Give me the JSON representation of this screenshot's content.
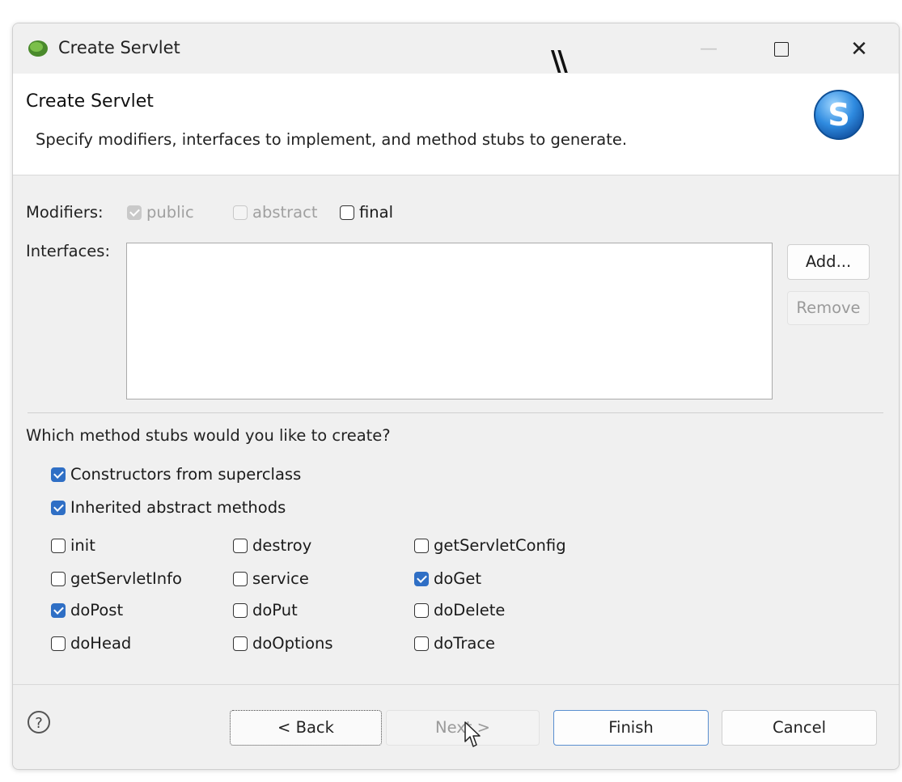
{
  "window": {
    "title": "Create Servlet",
    "controls": {
      "minimize": "—",
      "close": "✕"
    }
  },
  "banner": {
    "title": "Create Servlet",
    "description": "Specify modifiers, interfaces to implement, and method stubs to generate.",
    "logo_letter": "S",
    "stray_mark": "\\\\"
  },
  "modifiers": {
    "label": "Modifiers:",
    "options": [
      {
        "label": "public",
        "checked": true,
        "enabled": false
      },
      {
        "label": "abstract",
        "checked": false,
        "enabled": false
      },
      {
        "label": "final",
        "checked": false,
        "enabled": true
      }
    ]
  },
  "interfaces": {
    "label": "Interfaces:",
    "add_button": "Add...",
    "remove_button": "Remove"
  },
  "stubs": {
    "question": "Which method stubs would you like to create?",
    "general": [
      {
        "label": "Constructors from superclass",
        "checked": true
      },
      {
        "label": "Inherited abstract methods",
        "checked": true
      }
    ],
    "methods": [
      {
        "label": "init",
        "checked": false
      },
      {
        "label": "destroy",
        "checked": false
      },
      {
        "label": "getServletConfig",
        "checked": false
      },
      {
        "label": "getServletInfo",
        "checked": false
      },
      {
        "label": "service",
        "checked": false
      },
      {
        "label": "doGet",
        "checked": true
      },
      {
        "label": "doPost",
        "checked": true
      },
      {
        "label": "doPut",
        "checked": false
      },
      {
        "label": "doDelete",
        "checked": false
      },
      {
        "label": "doHead",
        "checked": false
      },
      {
        "label": "doOptions",
        "checked": false
      },
      {
        "label": "doTrace",
        "checked": false
      }
    ]
  },
  "footer": {
    "help_icon": "?",
    "back_button": "< Back",
    "next_button": "Next >",
    "finish_button": "Finish",
    "cancel_button": "Cancel"
  },
  "colors": {
    "accent": "#2f6fc5",
    "window_bg": "#f0f0f0",
    "banner_bg": "#ffffff"
  }
}
